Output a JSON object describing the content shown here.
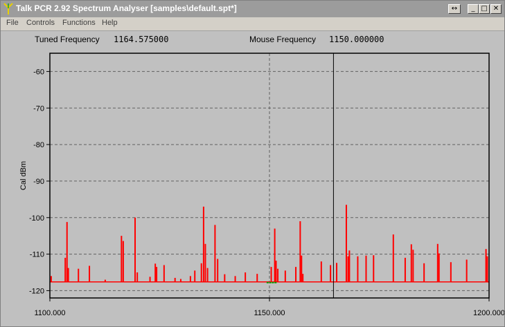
{
  "window": {
    "title": "Talk PCR 2.92 Spectrum Analyser [samples\\default.spt*]",
    "controls": {
      "restore_glyph": "↔",
      "minimize_glyph": "_",
      "maximize_glyph": "□",
      "close_glyph": "✕"
    }
  },
  "menu": {
    "items": [
      "File",
      "Controls",
      "Functions",
      "Help"
    ]
  },
  "readouts": {
    "tuned_label": "Tuned Frequency",
    "tuned_value": "1164.575000",
    "mouse_label": "Mouse Frequency",
    "mouse_value": "1150.000000"
  },
  "chart_data": {
    "type": "bar",
    "ylabel": "Cal dBm",
    "xlim": [
      1100,
      1200
    ],
    "ylim": [
      -122,
      -55
    ],
    "yticks": [
      {
        "value": -60,
        "label": "-60"
      },
      {
        "value": -70,
        "label": "-70"
      },
      {
        "value": -80,
        "label": "-80"
      },
      {
        "value": -90,
        "label": "-90"
      },
      {
        "value": -100,
        "label": "-100"
      },
      {
        "value": -110,
        "label": "-110"
      },
      {
        "value": -120,
        "label": "-120"
      }
    ],
    "xticks": [
      {
        "value": 1100,
        "label": "1100.000"
      },
      {
        "value": 1150,
        "label": "1150.000"
      },
      {
        "value": 1200,
        "label": "1200.000"
      }
    ],
    "grid": true,
    "baseline": -117.6,
    "cursor_x": 1164.575,
    "mouse_x": 1150,
    "colors": {
      "signal": "#ff0000",
      "noise": "#00a000",
      "cursor": "#000000",
      "grid": "#606060",
      "plot_bg": "#c0c0c0"
    },
    "x": [
      1100.3,
      1103.5,
      1103.9,
      1104.2,
      1106.5,
      1109.0,
      1112.6,
      1116.3,
      1116.7,
      1119.4,
      1119.9,
      1122.8,
      1124.0,
      1124.3,
      1126.0,
      1128.5,
      1129.8,
      1132.0,
      1133.0,
      1134.5,
      1135.0,
      1135.4,
      1135.9,
      1137.6,
      1138.2,
      1139.8,
      1142.2,
      1144.5,
      1147.2,
      1150.4,
      1151.2,
      1151.5,
      1151.9,
      1153.6,
      1156.0,
      1157.0,
      1157.3,
      1157.6,
      1161.8,
      1163.9,
      1165.3,
      1167.5,
      1167.9,
      1168.2,
      1170.1,
      1172.0,
      1173.7,
      1178.2,
      1180.9,
      1182.3,
      1182.7,
      1185.2,
      1188.3,
      1188.6,
      1191.3,
      1194.9,
      1199.3,
      1199.6
    ],
    "values": [
      -116.0,
      -111.0,
      -101.2,
      -113.8,
      -114.0,
      -113.2,
      -117.0,
      -105.0,
      -106.4,
      -100.0,
      -115.0,
      -116.2,
      -112.6,
      -113.5,
      -113.0,
      -116.5,
      -116.8,
      -116.0,
      -114.5,
      -112.5,
      -97.0,
      -107.2,
      -113.8,
      -102.0,
      -111.3,
      -115.5,
      -116.0,
      -115.0,
      -115.4,
      -113.5,
      -103.0,
      -111.8,
      -114.0,
      -114.5,
      -113.5,
      -101.0,
      -110.4,
      -115.4,
      -112.0,
      -113.0,
      -112.4,
      -96.5,
      -110.6,
      -109.0,
      -110.6,
      -110.4,
      -110.3,
      -104.6,
      -111.0,
      -107.3,
      -108.8,
      -112.5,
      -107.2,
      -109.8,
      -112.2,
      -111.5,
      -108.6,
      -110.6
    ],
    "noise_x": [
      1149.5,
      1150.1,
      1150.7,
      1151.3
    ]
  }
}
